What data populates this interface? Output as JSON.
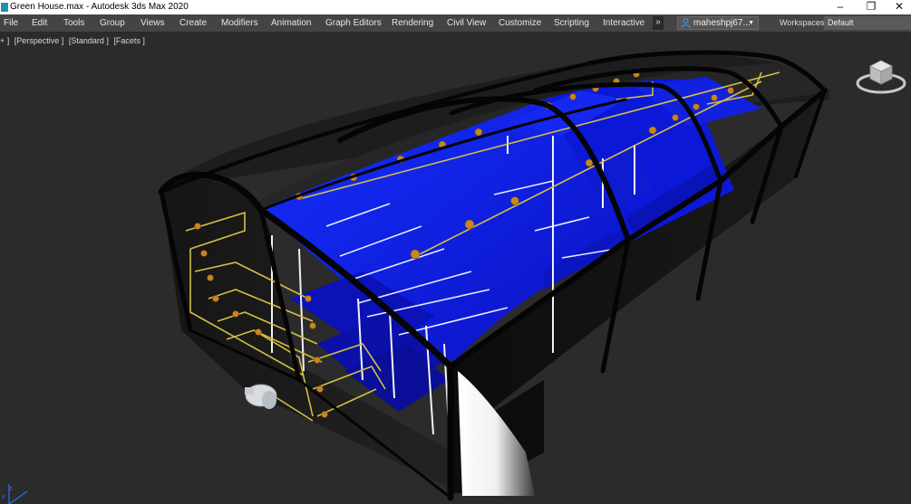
{
  "window": {
    "title": "Green House.max - Autodesk 3ds Max 2020",
    "minimize": "–",
    "restore": "❐",
    "close": "✕"
  },
  "menu": [
    "File",
    "Edit",
    "Tools",
    "Group",
    "Views",
    "Create",
    "Modifiers",
    "Animation",
    "Graph Editors",
    "Rendering",
    "Civil View",
    "Customize",
    "Scripting",
    "Interactive"
  ],
  "overflow_label": "»",
  "user": {
    "name": "maheshpj67...",
    "icon": "user-icon"
  },
  "workspaces": {
    "label": "Workspaces:",
    "value": "Default"
  },
  "viewport": {
    "labels": [
      "+ ]",
      "[Perspective ]",
      "[Standard ]",
      "[Facets ]"
    ]
  },
  "axis": {
    "x": "x",
    "z": "z"
  },
  "colors": {
    "viewport_bg": "#2b2b2b",
    "menubar_bg": "#444444",
    "panel_blue": "#0a14d8",
    "pipe_yellow": "#d6c24a",
    "sprinkler_orange": "#c9871f",
    "frame_black": "#0a0a0a"
  }
}
